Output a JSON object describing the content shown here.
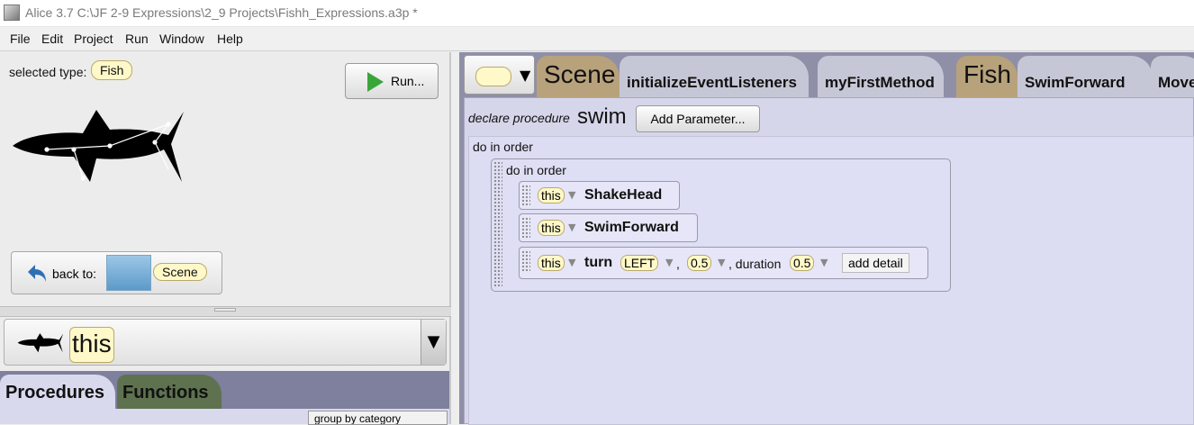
{
  "window": {
    "title": "Alice 3.7 C:\\JF 2-9 Expressions\\2_9 Projects\\Fishh_Expressions.a3p *"
  },
  "menu": [
    "File",
    "Edit",
    "Project",
    "Run",
    "Window",
    "Help"
  ],
  "left": {
    "selected_type_label": "selected type:",
    "selected_type": "Fish",
    "run_label": "Run...",
    "back_to_label": "back to:",
    "back_to_scene": "Scene",
    "instance": "this",
    "tabs": [
      "Procedures",
      "Functions"
    ],
    "group_by": "group by category"
  },
  "right": {
    "tabs": {
      "scene": "Scene",
      "init": "initializeEventListeners",
      "first": "myFirstMethod",
      "fish": "Fish",
      "swim": "SwimForward",
      "move": "Move"
    },
    "declare_label": "declare procedure",
    "procedure_name": "swim",
    "add_parameter": "Add Parameter...",
    "outer_label": "do in order",
    "inner_label": "do in order",
    "statements": {
      "s1": {
        "target": "this",
        "method": "ShakeHead"
      },
      "s2": {
        "target": "this",
        "method": "SwimForward"
      },
      "s3": {
        "target": "this",
        "method": "turn",
        "direction": "LEFT",
        "comma": ",",
        "amount": "0.5",
        "duration_label": ", duration",
        "duration": "0.5",
        "add_detail": "add detail"
      }
    }
  },
  "colors": {
    "accent_yellow": "#fff8c8",
    "scene_tab": "#b8a27c",
    "functions_tab": "#5e724f"
  }
}
